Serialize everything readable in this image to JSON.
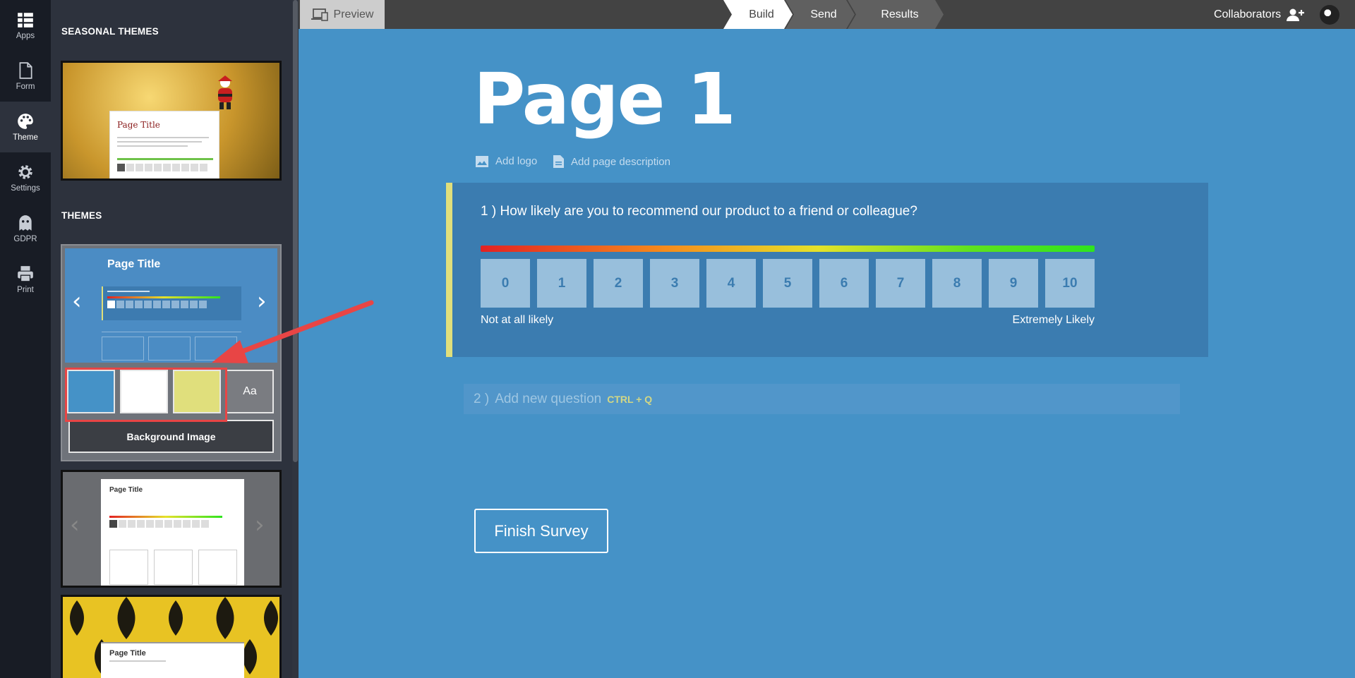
{
  "rail": {
    "items": [
      {
        "label": "Apps",
        "icon": "grid-icon"
      },
      {
        "label": "Form",
        "icon": "document-icon"
      },
      {
        "label": "Theme",
        "icon": "palette-icon"
      },
      {
        "label": "Settings",
        "icon": "gear-icon"
      },
      {
        "label": "GDPR",
        "icon": "ghost-icon"
      },
      {
        "label": "Print",
        "icon": "printer-icon"
      }
    ],
    "active": "Theme"
  },
  "panel": {
    "seasonal_title": "SEASONAL THEMES",
    "themes_title": "THEMES",
    "seasonal_thumb_title": "Page Title",
    "active_theme": {
      "preview_title": "Page Title",
      "swatches": [
        {
          "name": "background",
          "color": "#4592c7"
        },
        {
          "name": "text",
          "color": "#ffffff"
        },
        {
          "name": "accent",
          "color": "#e0df7c"
        }
      ],
      "font_button": "Aa",
      "background_image_button": "Background Image"
    },
    "white_theme_title": "Page Title",
    "yellow_theme_title": "Page Title"
  },
  "topbar": {
    "preview": "Preview",
    "steps": [
      "Build",
      "Send",
      "Results"
    ],
    "active_step": "Build",
    "collaborators": "Collaborators"
  },
  "page": {
    "title": "Page 1",
    "add_logo": "Add logo",
    "add_description": "Add page description",
    "question": {
      "number": "1 )",
      "text": "How likely are you to recommend our product to a friend or colleague?",
      "scale": [
        "0",
        "1",
        "2",
        "3",
        "4",
        "5",
        "6",
        "7",
        "8",
        "9",
        "10"
      ],
      "low_label": "Not at all likely",
      "high_label": "Extremely Likely"
    },
    "add_question": {
      "number": "2 )",
      "text": "Add new question",
      "shortcut": "CTRL + Q"
    },
    "finish_button": "Finish Survey"
  },
  "colors": {
    "canvas_bg": "#4592c7",
    "question_bg": "#3b7cb0",
    "accent": "#e0df7c",
    "annotation": "#e84545"
  }
}
